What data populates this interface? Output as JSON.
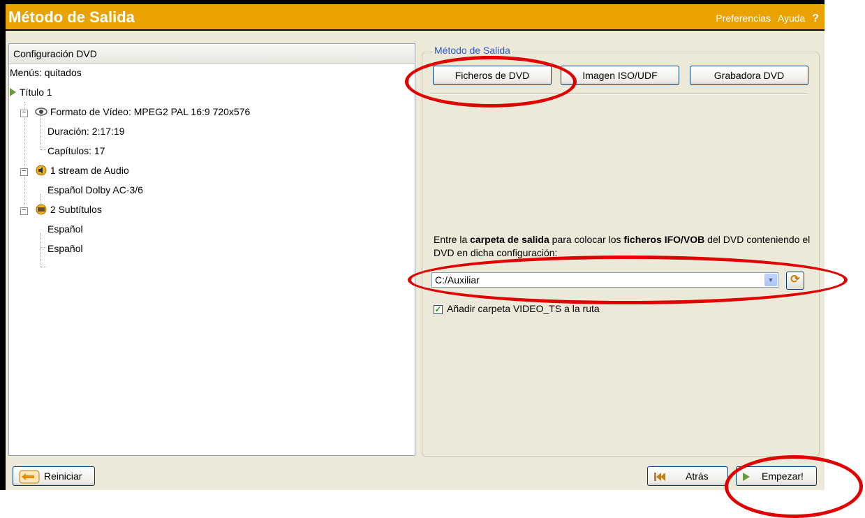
{
  "window": {
    "title": "Método de Salida",
    "links": [
      "Preferencias",
      "Ayuda"
    ],
    "help": "?"
  },
  "left": {
    "header": "Configuración DVD",
    "menus": "Menús: quitados",
    "title1": "Título 1",
    "video": "Formato de Vídeo: MPEG2 PAL 16:9 720x576",
    "duration": "Duración: 2:17:19",
    "chapters": "Capítulos: 17",
    "audio": "1 stream de Audio",
    "audio_item": "Español Dolby AC-3/6",
    "subs": "2 Subtítulos",
    "sub1": "Español",
    "sub2": "Español"
  },
  "right": {
    "group_label": "Método de Salida",
    "btn_files": "Ficheros de DVD",
    "btn_iso": "Imagen ISO/UDF",
    "btn_burner": "Grabadora DVD",
    "desc_1": "Entre la ",
    "desc_b1": "carpeta de salida",
    "desc_2": " para colocar los ",
    "desc_b2": "ficheros IFO/VOB",
    "desc_3": " del DVD conteniendo el DVD en dicha configuración:",
    "folder": "C:/Auxiliar",
    "checkbox_label": "Añadir carpeta VIDEO_TS a la ruta",
    "checked": true
  },
  "bottom": {
    "reset": "Reiniciar",
    "back": "Atrás",
    "start": "Empezar!"
  },
  "colors": {
    "titlebar": "#e9a200",
    "annotation": "#e00000",
    "link": "#2a5ad0"
  }
}
